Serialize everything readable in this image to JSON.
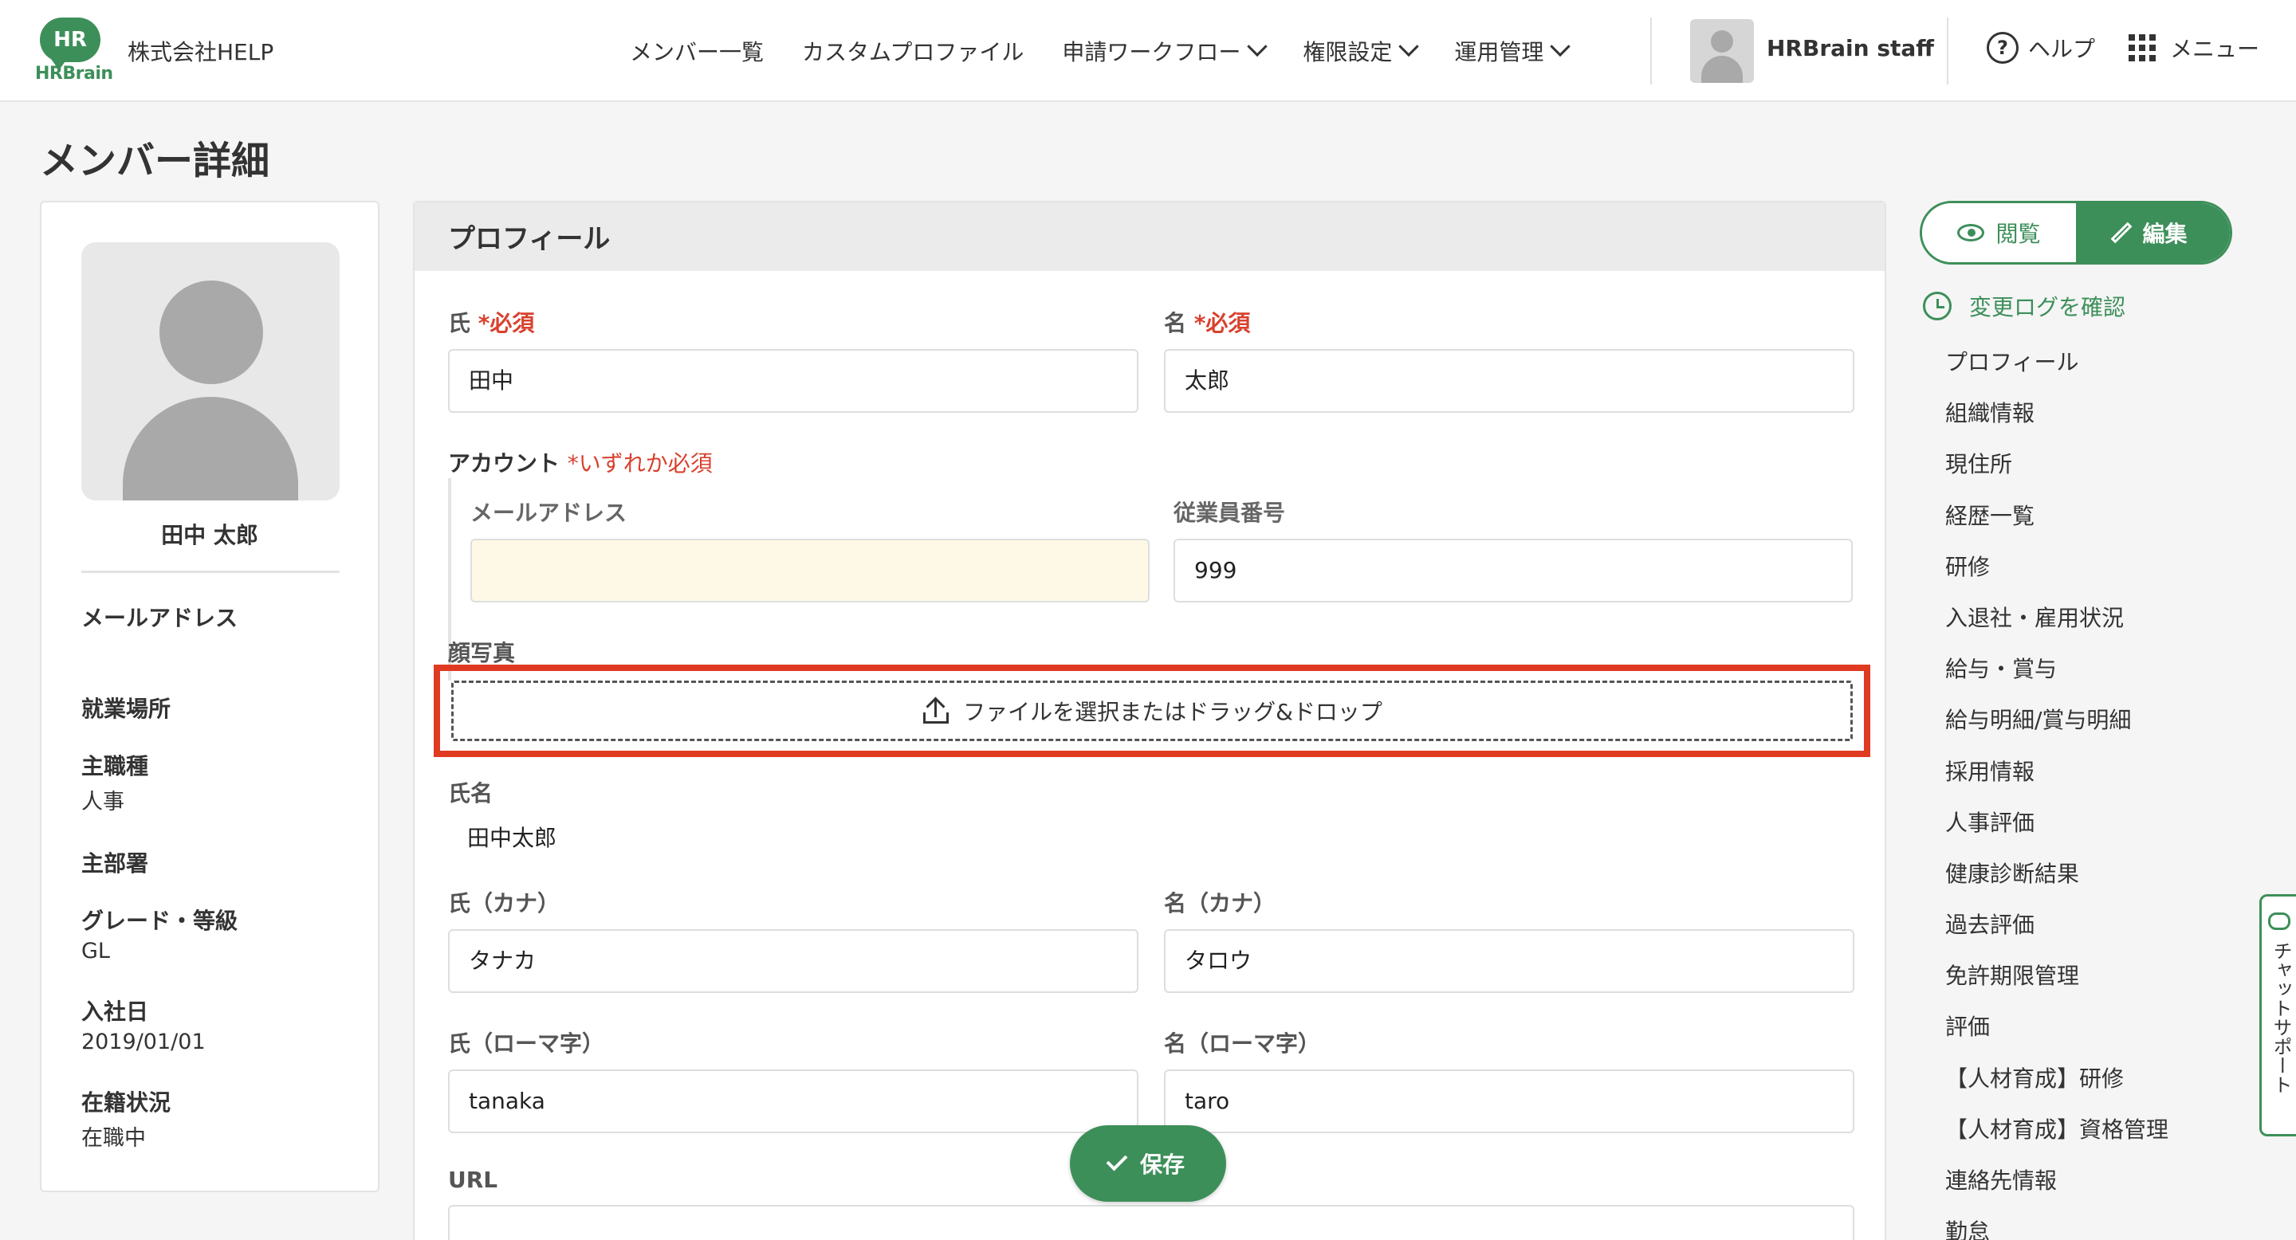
{
  "header": {
    "logo_top": "HR",
    "logo_bottom": "HRBrain",
    "company": "株式会社HELP",
    "nav": [
      {
        "label": "メンバー一覧"
      },
      {
        "label": "カスタムプロファイル"
      },
      {
        "label": "申請ワークフロー"
      },
      {
        "label": "権限設定"
      },
      {
        "label": "運用管理"
      }
    ],
    "user": "HRBrain staff",
    "help": "ヘルプ",
    "menu": "メニュー"
  },
  "page_title": "メンバー詳細",
  "summary": {
    "name": "田中 太郎",
    "email_label": "メールアドレス",
    "workplace_label": "就業場所",
    "job_label": "主職種",
    "job_value": "人事",
    "dept_label": "主部署",
    "grade_label": "グレード・等級",
    "grade_value": "GL",
    "joined_label": "入社日",
    "joined_value": "2019/01/01",
    "status_label": "在籍状況",
    "status_value": "在職中"
  },
  "profile": {
    "section_title": "プロフィール",
    "last_name_label": "氏",
    "first_name_label": "名",
    "required": "*必須",
    "last_name": "田中",
    "first_name": "太郎",
    "account_label": "アカウント",
    "account_required": "*いずれか必須",
    "email_label": "メールアドレス",
    "email_value": "",
    "employee_no_label": "従業員番号",
    "employee_no": "999",
    "photo_label": "顔写真",
    "upload_text": "ファイルを選択またはドラッグ&ドロップ",
    "full_name_label": "氏名",
    "full_name": "田中太郎",
    "last_kana_label": "氏（カナ）",
    "first_kana_label": "名（カナ）",
    "last_kana": "タナカ",
    "first_kana": "タロウ",
    "last_roman_label": "氏（ローマ字）",
    "first_roman_label": "名（ローマ字）",
    "last_roman": "tanaka",
    "first_roman": "taro",
    "url_label": "URL",
    "url_value": ""
  },
  "save_label": "保存",
  "mode": {
    "view": "閲覧",
    "edit": "編集"
  },
  "changelog": "変更ログを確認",
  "side_nav": [
    "プロフィール",
    "組織情報",
    "現住所",
    "経歴一覧",
    "研修",
    "入退社・雇用状況",
    "給与・賞与",
    "給与明細/賞与明細",
    "採用情報",
    "人事評価",
    "健康診断結果",
    "過去評価",
    "免許期限管理",
    "評価",
    "【人材育成】研修",
    "【人材育成】資格管理",
    "連絡先情報",
    "勤怠"
  ],
  "chat_support": "チャットサポート",
  "colors": {
    "brand": "#3d8f5a",
    "required": "#d9412e",
    "highlight": "#e03a22"
  }
}
